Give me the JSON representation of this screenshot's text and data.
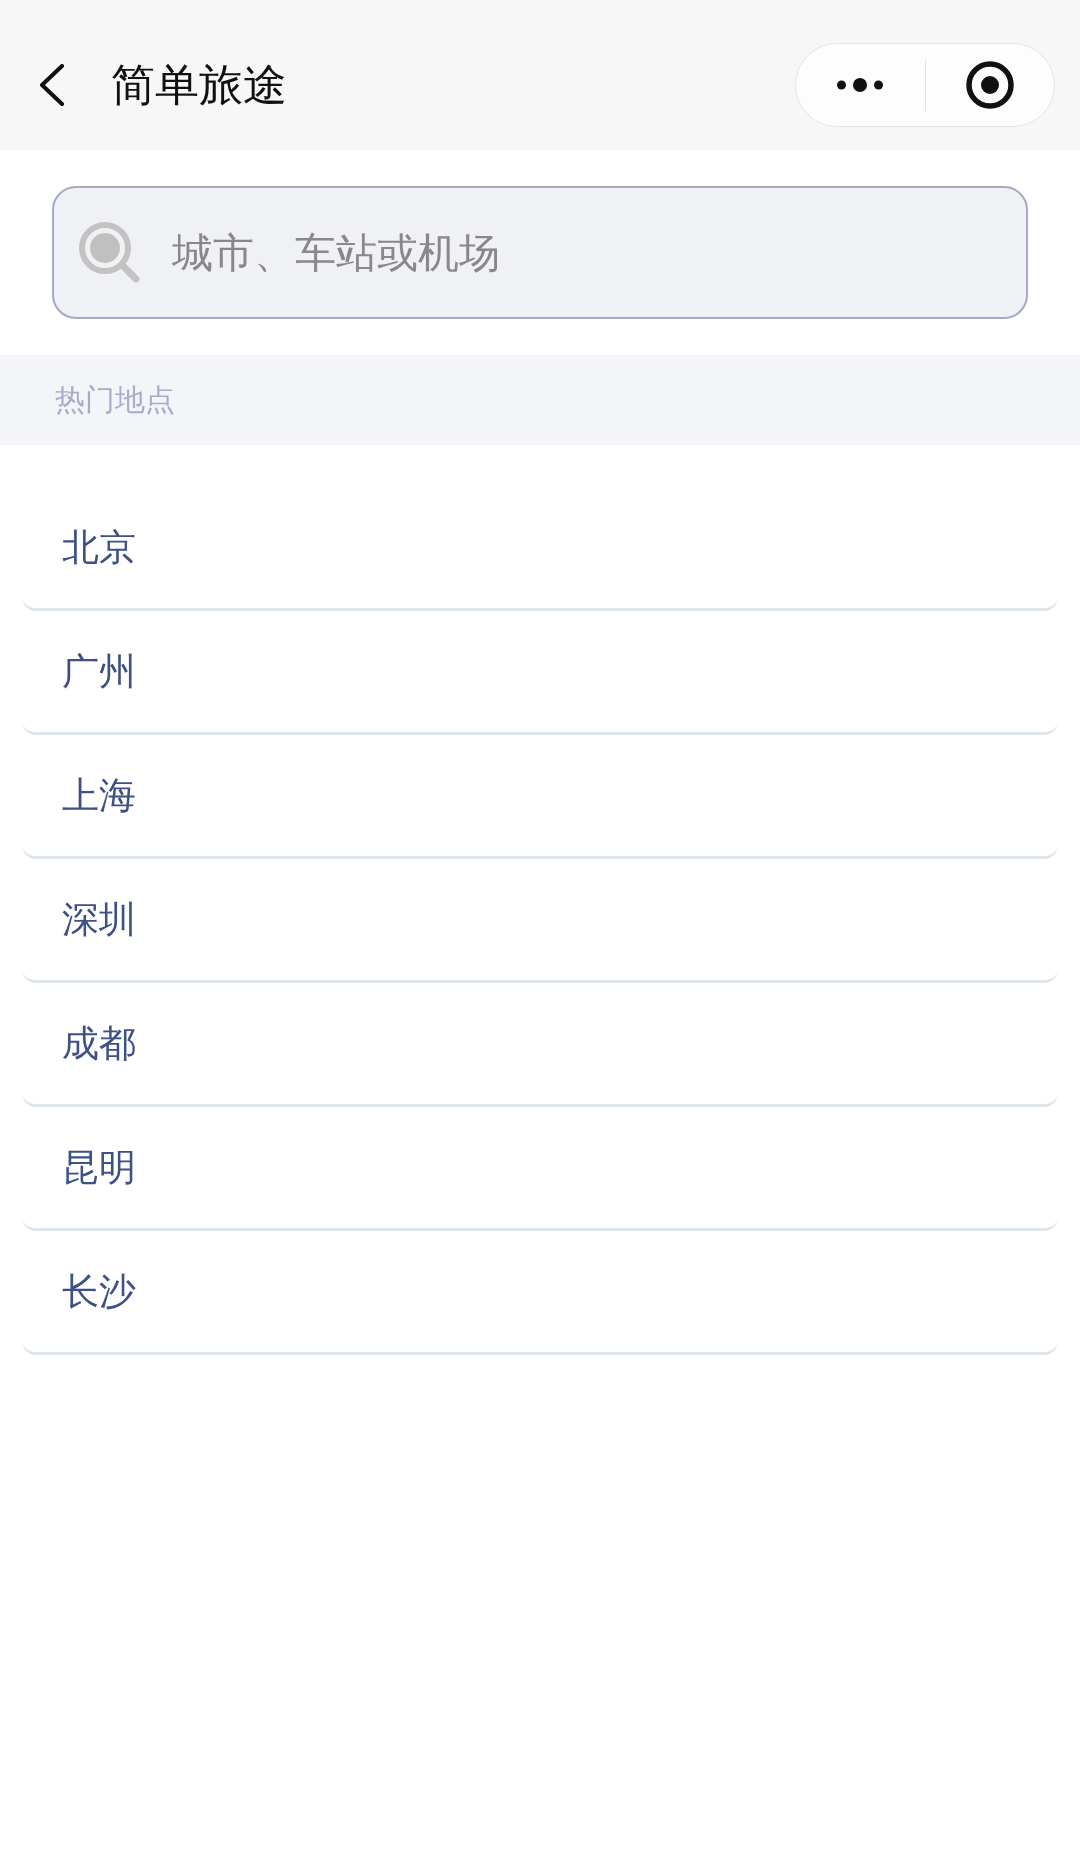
{
  "nav_bar": {
    "title": "简单旅途"
  },
  "search": {
    "placeholder": "城市、车站或机场"
  },
  "section": {
    "title": "热门地点"
  },
  "cities": [
    {
      "name": "北京"
    },
    {
      "name": "广州"
    },
    {
      "name": "上海"
    },
    {
      "name": "深圳"
    },
    {
      "name": "成都"
    },
    {
      "name": "昆明"
    },
    {
      "name": "长沙"
    }
  ]
}
